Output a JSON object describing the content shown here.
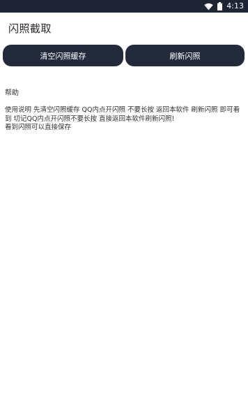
{
  "status_bar": {
    "time": "4:13",
    "wifi_icon": "wifi-icon",
    "battery_icon": "battery-icon",
    "background": "#1f2535"
  },
  "app_bar": {
    "title": "闪照截取"
  },
  "buttons": {
    "clear_cache_label": "清空闪照缓存",
    "refresh_label": "刷新闪照",
    "color": "#222a3c"
  },
  "help": {
    "title": "帮助",
    "body": "使用说明 先清空闪照缓存 QQ内点开闪照 不要长按 返回本软件 刷新闪照 即可看到 切记QQ内点开闪照不要长按 直接返回本软件刷新闪照!\n看到闪照可以直接保存"
  }
}
